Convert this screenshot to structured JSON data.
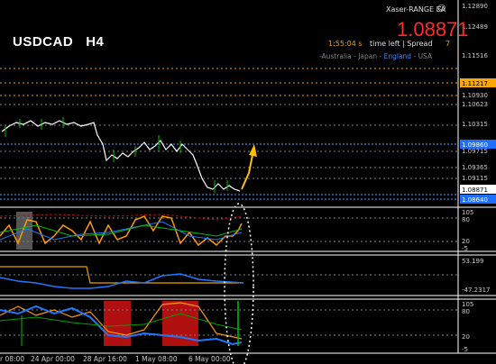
{
  "header": {
    "symbol": "USDCAD",
    "timeframe": "H4",
    "ea_name": "Xaser-RANGE EA",
    "gear_icon": "gear-icon",
    "bid_price": "1.08871",
    "timer": "1:55:04 s",
    "time_left_label": "time left | Spread",
    "spread": "7",
    "sessions": [
      "Australia",
      "Japan",
      "England",
      "USA"
    ],
    "active_session": "England"
  },
  "price_axis": {
    "labels": [
      "1.12890",
      "1.12489",
      "1.11516",
      "1.10930",
      "1.10623",
      "1.10315",
      "1.09715",
      "1.09365",
      "1.09115",
      "1.08871",
      "1.08640"
    ],
    "highlighted": [
      {
        "text": "1.11217",
        "bg": "#ffa500",
        "fg": "#000000"
      },
      {
        "text": "1.09860",
        "bg": "#1e6fff",
        "fg": "#ffffff"
      },
      {
        "text": "1.08871",
        "bg": "#ffffff",
        "fg": "#000000"
      },
      {
        "text": "1.08640",
        "bg": "#1e6fff",
        "fg": "#ffffff"
      }
    ]
  },
  "indicator_axes": {
    "stoch": [
      "105",
      "80",
      "20",
      "-5"
    ],
    "cci": [
      "53.199",
      "-47.2317"
    ],
    "bottom": [
      "105",
      "80",
      "20",
      "-5"
    ]
  },
  "time_axis": {
    "labels": [
      "r 08:00",
      "24 Apr 00:00",
      "28 Apr 16:00",
      "1 May 08:00",
      "6 May 00:00"
    ]
  },
  "colors": {
    "background": "#000000",
    "candle": "#ffffff",
    "bull": "#00c000",
    "arrow": "#ffc000",
    "orange_line": "#ff9900",
    "blue_line": "#1e78ff",
    "red_block": "#b01010",
    "session_active": "#3b8fff"
  }
}
